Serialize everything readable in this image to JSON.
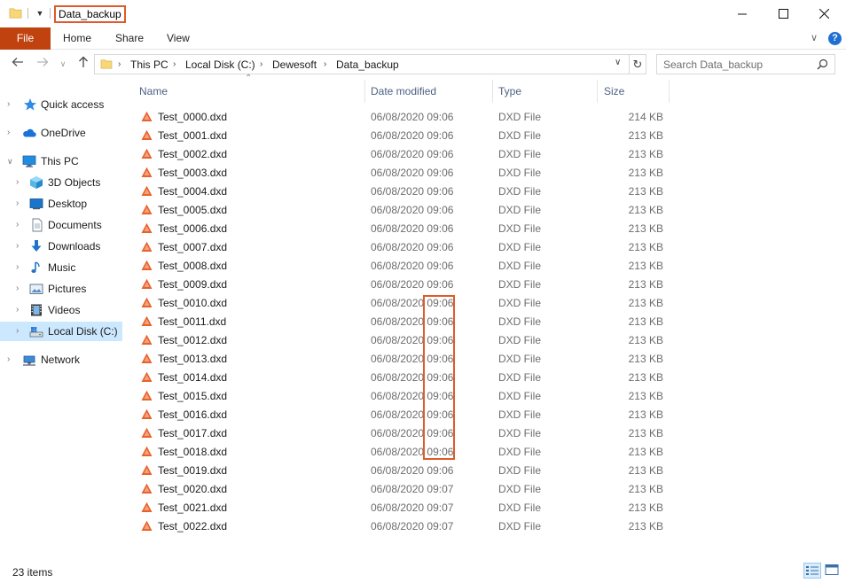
{
  "window": {
    "title": "Data_backup",
    "highlight_color": "#e05a2b"
  },
  "ribbon": {
    "tabs": [
      "File",
      "Home",
      "Share",
      "View"
    ],
    "file_color": "#c0420f"
  },
  "address": {
    "crumbs": [
      "This PC",
      "Local Disk (C:)",
      "Dewesoft",
      "Data_backup"
    ]
  },
  "search": {
    "placeholder": "Search Data_backup"
  },
  "sidebar": {
    "items": [
      {
        "label": "Quick access",
        "icon": "star-icon"
      },
      {
        "label": "OneDrive",
        "icon": "cloud-icon"
      },
      {
        "label": "This PC",
        "icon": "computer-icon"
      },
      {
        "label": "3D Objects",
        "icon": "cube-icon"
      },
      {
        "label": "Desktop",
        "icon": "desktop-icon"
      },
      {
        "label": "Documents",
        "icon": "document-icon"
      },
      {
        "label": "Downloads",
        "icon": "download-icon"
      },
      {
        "label": "Music",
        "icon": "music-icon"
      },
      {
        "label": "Pictures",
        "icon": "picture-icon"
      },
      {
        "label": "Videos",
        "icon": "video-icon"
      },
      {
        "label": "Local Disk (C:)",
        "icon": "drive-icon"
      },
      {
        "label": "Network",
        "icon": "network-icon"
      }
    ]
  },
  "columns": {
    "name": "Name",
    "date": "Date modified",
    "type": "Type",
    "size": "Size"
  },
  "files": [
    {
      "name": "Test_0000.dxd",
      "date": "06/08/2020 09:06",
      "type": "DXD File",
      "size": "214 KB"
    },
    {
      "name": "Test_0001.dxd",
      "date": "06/08/2020 09:06",
      "type": "DXD File",
      "size": "213 KB"
    },
    {
      "name": "Test_0002.dxd",
      "date": "06/08/2020 09:06",
      "type": "DXD File",
      "size": "213 KB"
    },
    {
      "name": "Test_0003.dxd",
      "date": "06/08/2020 09:06",
      "type": "DXD File",
      "size": "213 KB"
    },
    {
      "name": "Test_0004.dxd",
      "date": "06/08/2020 09:06",
      "type": "DXD File",
      "size": "213 KB"
    },
    {
      "name": "Test_0005.dxd",
      "date": "06/08/2020 09:06",
      "type": "DXD File",
      "size": "213 KB"
    },
    {
      "name": "Test_0006.dxd",
      "date": "06/08/2020 09:06",
      "type": "DXD File",
      "size": "213 KB"
    },
    {
      "name": "Test_0007.dxd",
      "date": "06/08/2020 09:06",
      "type": "DXD File",
      "size": "213 KB"
    },
    {
      "name": "Test_0008.dxd",
      "date": "06/08/2020 09:06",
      "type": "DXD File",
      "size": "213 KB"
    },
    {
      "name": "Test_0009.dxd",
      "date": "06/08/2020 09:06",
      "type": "DXD File",
      "size": "213 KB"
    },
    {
      "name": "Test_0010.dxd",
      "date": "06/08/2020 09:06",
      "type": "DXD File",
      "size": "213 KB"
    },
    {
      "name": "Test_0011.dxd",
      "date": "06/08/2020 09:06",
      "type": "DXD File",
      "size": "213 KB"
    },
    {
      "name": "Test_0012.dxd",
      "date": "06/08/2020 09:06",
      "type": "DXD File",
      "size": "213 KB"
    },
    {
      "name": "Test_0013.dxd",
      "date": "06/08/2020 09:06",
      "type": "DXD File",
      "size": "213 KB"
    },
    {
      "name": "Test_0014.dxd",
      "date": "06/08/2020 09:06",
      "type": "DXD File",
      "size": "213 KB"
    },
    {
      "name": "Test_0015.dxd",
      "date": "06/08/2020 09:06",
      "type": "DXD File",
      "size": "213 KB"
    },
    {
      "name": "Test_0016.dxd",
      "date": "06/08/2020 09:06",
      "type": "DXD File",
      "size": "213 KB"
    },
    {
      "name": "Test_0017.dxd",
      "date": "06/08/2020 09:06",
      "type": "DXD File",
      "size": "213 KB"
    },
    {
      "name": "Test_0018.dxd",
      "date": "06/08/2020 09:06",
      "type": "DXD File",
      "size": "213 KB"
    },
    {
      "name": "Test_0019.dxd",
      "date": "06/08/2020 09:06",
      "type": "DXD File",
      "size": "213 KB"
    },
    {
      "name": "Test_0020.dxd",
      "date": "06/08/2020 09:07",
      "type": "DXD File",
      "size": "213 KB"
    },
    {
      "name": "Test_0021.dxd",
      "date": "06/08/2020 09:07",
      "type": "DXD File",
      "size": "213 KB"
    },
    {
      "name": "Test_0022.dxd",
      "date": "06/08/2020 09:07",
      "type": "DXD File",
      "size": "213 KB"
    }
  ],
  "status": {
    "items_text": "23 items"
  }
}
